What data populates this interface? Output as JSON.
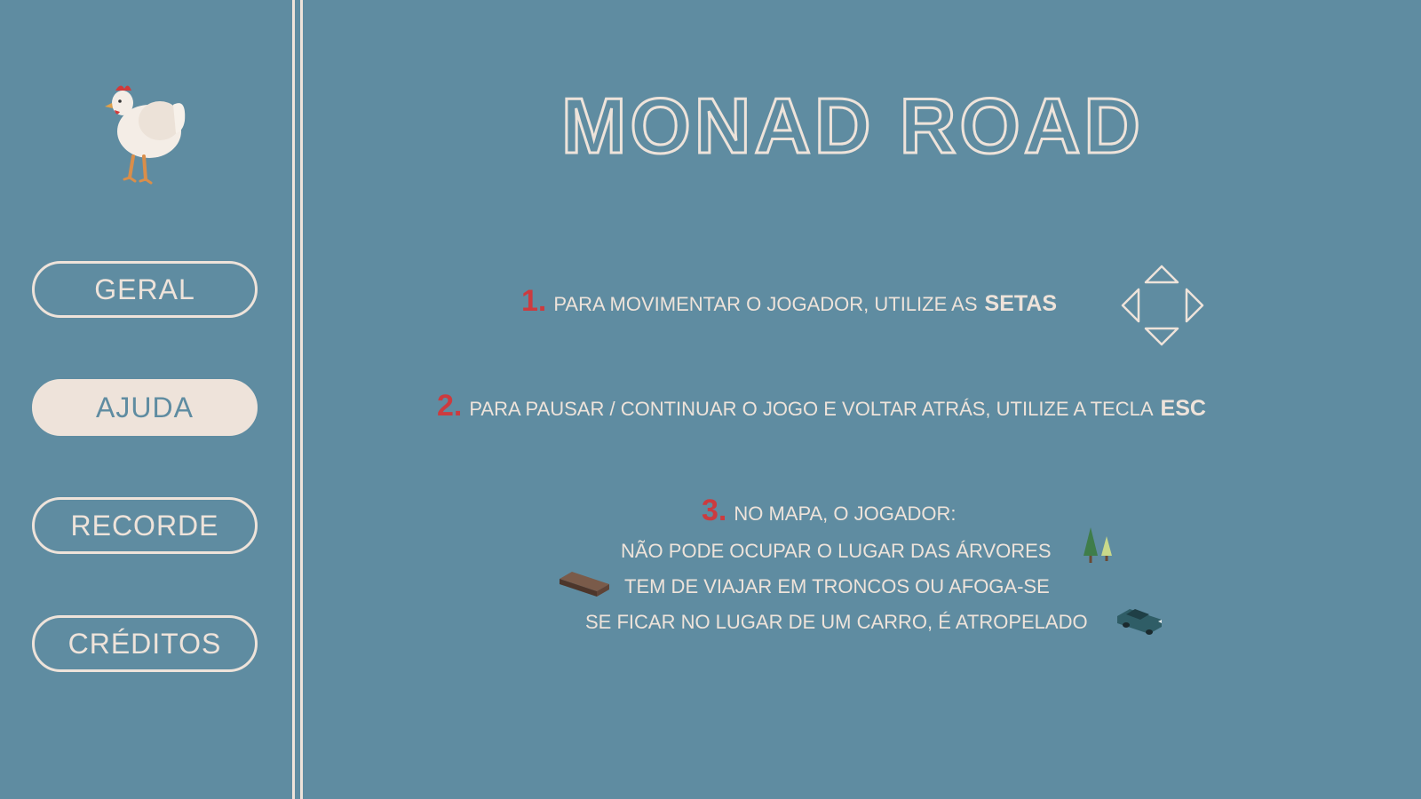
{
  "game": {
    "title": "MONAD ROAD"
  },
  "sidebar": {
    "items": [
      {
        "label": "GERAL",
        "active": false
      },
      {
        "label": "AJUDA",
        "active": true
      },
      {
        "label": "RECORDE",
        "active": false
      },
      {
        "label": "CRÉDITOS",
        "active": false
      }
    ]
  },
  "help": {
    "rule1": {
      "number": "1.",
      "text": "PARA MOVIMENTAR O JOGADOR, UTILIZE AS",
      "key": "SETAS",
      "icon": "arrow-keys-icon"
    },
    "rule2": {
      "number": "2.",
      "text": "PARA PAUSAR / CONTINUAR O JOGO E VOLTAR ATRÁS, UTILIZE A TECLA",
      "key": "ESC"
    },
    "rule3": {
      "number": "3.",
      "text": "NO MAPA, O JOGADOR:",
      "lines": [
        {
          "text": "NÃO PODE OCUPAR O LUGAR DAS ÁRVORES",
          "icon": "trees-icon"
        },
        {
          "text": "TEM DE VIAJAR EM TRONCOS OU AFOGA-SE",
          "icon": "log-icon"
        },
        {
          "text": "SE FICAR NO LUGAR DE UM CARRO, É ATROPELADO",
          "icon": "car-icon"
        }
      ]
    }
  },
  "colors": {
    "background": "#5f8ca1",
    "text": "#eee3da",
    "accent": "#cc3b3f"
  }
}
